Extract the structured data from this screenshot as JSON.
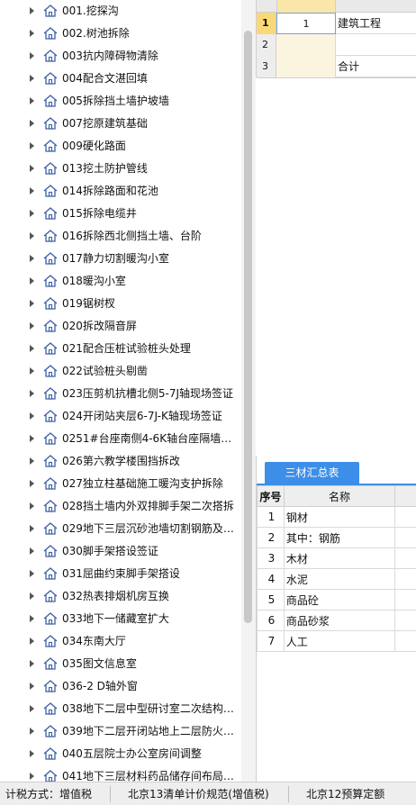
{
  "tree": {
    "items": [
      {
        "label": "001.挖探沟"
      },
      {
        "label": "002.树池拆除"
      },
      {
        "label": "003抗内障碍物清除"
      },
      {
        "label": "004配合文湛回填"
      },
      {
        "label": "005拆除挡土墙护坡墙"
      },
      {
        "label": "007挖原建筑基础"
      },
      {
        "label": "009硬化路面"
      },
      {
        "label": "013挖土防护管线"
      },
      {
        "label": "014拆除路面和花池"
      },
      {
        "label": "015拆除电缆井"
      },
      {
        "label": "016拆除西北侧挡土墙、台阶"
      },
      {
        "label": "017静力切割暖沟小室"
      },
      {
        "label": "018暖沟小室"
      },
      {
        "label": "019锯树杈"
      },
      {
        "label": "020拆改隔音屏"
      },
      {
        "label": "021配合压桩试验桩头处理"
      },
      {
        "label": "022试验桩头剔凿"
      },
      {
        "label": "023压剪机抗槽北侧5-7J轴现场签证"
      },
      {
        "label": "024开闭站夹层6-7J-K轴现场签证"
      },
      {
        "label": "0251#台座南侧4-6K轴台座隔墙端…"
      },
      {
        "label": "026第六教学楼围挡拆改"
      },
      {
        "label": "027独立柱基础施工暖沟支护拆除"
      },
      {
        "label": "028挡土墙内外双排脚手架二次搭拆"
      },
      {
        "label": "029地下三层沉砂池墙切割钢筋及…"
      },
      {
        "label": "030脚手架搭设签证"
      },
      {
        "label": "031屈曲约束脚手架搭设"
      },
      {
        "label": "032热表排烟机房互换"
      },
      {
        "label": "033地下一储藏室扩大"
      },
      {
        "label": "034东南大厅"
      },
      {
        "label": "035图文信息室"
      },
      {
        "label": "036-2 D轴外窗"
      },
      {
        "label": "038地下二层中型研讨室二次结构…"
      },
      {
        "label": "039地下二层开闭站地上二层防火…"
      },
      {
        "label": "040五层院士办公室房间调整"
      },
      {
        "label": "041地下三层材料药品储存间布局…"
      }
    ]
  },
  "grid_top": {
    "rows": [
      {
        "num": "1",
        "c1": "1",
        "c2": "建筑工程"
      },
      {
        "num": "2",
        "c1": "",
        "c2": ""
      },
      {
        "num": "3",
        "c1": "",
        "c2": "合计"
      }
    ]
  },
  "summary": {
    "tab_label": "三材汇总表",
    "headers": {
      "seq": "序号",
      "name": "名称"
    },
    "rows": [
      {
        "seq": "1",
        "name": "钢材"
      },
      {
        "seq": "2",
        "name": "其中：钢筋"
      },
      {
        "seq": "3",
        "name": "木材"
      },
      {
        "seq": "4",
        "name": "水泥"
      },
      {
        "seq": "5",
        "name": "商品砼"
      },
      {
        "seq": "6",
        "name": "商品砂浆"
      },
      {
        "seq": "7",
        "name": "人工"
      }
    ]
  },
  "status_bar": {
    "tax_mode": "计税方式：增值税",
    "spec": "北京13清单计价规范(增值税)",
    "quota": "北京12预算定额"
  },
  "colors": {
    "accent": "#3d8ee8",
    "active_row": "#f9d977",
    "icon": "#3b5fa6"
  },
  "icons": {
    "tree_node": "house-icon",
    "expander": "triangle-right-icon"
  }
}
